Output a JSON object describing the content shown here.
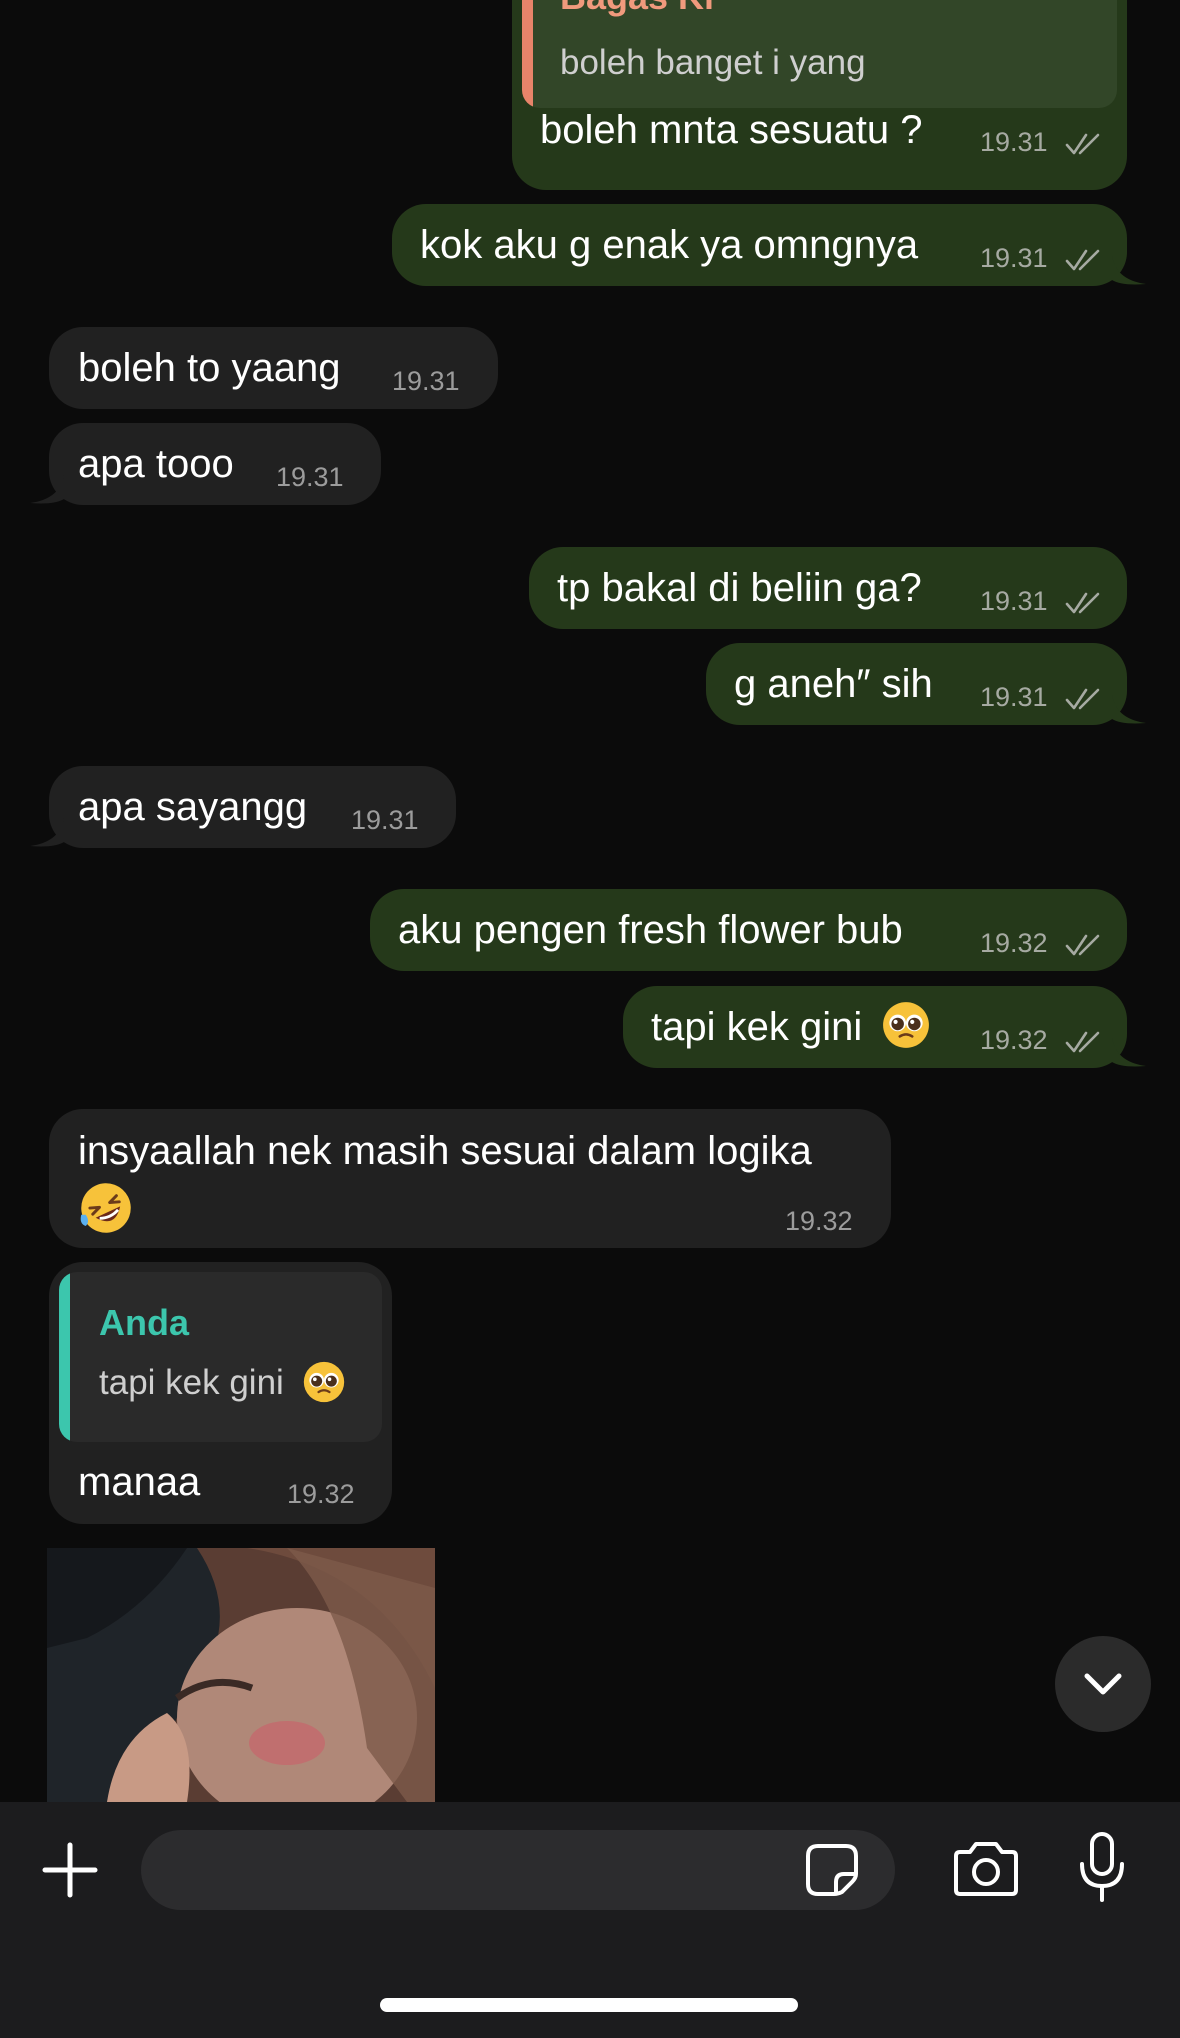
{
  "messages": [
    {
      "dir": "out",
      "quote": {
        "name": "Bagas Ki",
        "text": "boleh banget i yang"
      },
      "text": "boleh mnta sesuatu ?",
      "time": "19.31"
    },
    {
      "dir": "out",
      "text": "kok aku g enak ya omngnya",
      "time": "19.31"
    },
    {
      "dir": "in",
      "text": "boleh to yaang",
      "time": "19.31"
    },
    {
      "dir": "in",
      "text": "apa tooo",
      "time": "19.31"
    },
    {
      "dir": "out",
      "text": "tp bakal di beliin ga?",
      "time": "19.31"
    },
    {
      "dir": "out",
      "text": "g aneh″ sih",
      "time": "19.31"
    },
    {
      "dir": "in",
      "text": "apa sayangg",
      "time": "19.31"
    },
    {
      "dir": "out",
      "text": "aku pengen fresh flower bub",
      "time": "19.32"
    },
    {
      "dir": "out",
      "text": "tapi kek gini",
      "emoji": "pleading-face",
      "time": "19.32"
    },
    {
      "dir": "in",
      "text": "insyaallah nek masih sesuai dalam logika",
      "emoji": "rolling-on-floor-laughing",
      "time": "19.32"
    },
    {
      "dir": "in",
      "quote": {
        "name": "Anda",
        "text": "tapi kek gini",
        "emoji": "pleading-face"
      },
      "text": "manaa",
      "time": "19.32"
    }
  ],
  "colors": {
    "outgoing_bubble": "#25391a",
    "incoming_bubble": "#212121",
    "quote_bar_outgoing": "#e8846a",
    "quote_bar_incoming": "#3cc6ad",
    "quote_name_outgoing": "#f09a7d",
    "quote_name_incoming": "#3cc6ad"
  },
  "icons": {
    "read_receipt": "double-check-icon",
    "scroll_down": "chevron-down-icon",
    "attach": "plus-icon",
    "sticker": "sticker-icon",
    "camera": "camera-icon",
    "microphone": "microphone-icon"
  }
}
